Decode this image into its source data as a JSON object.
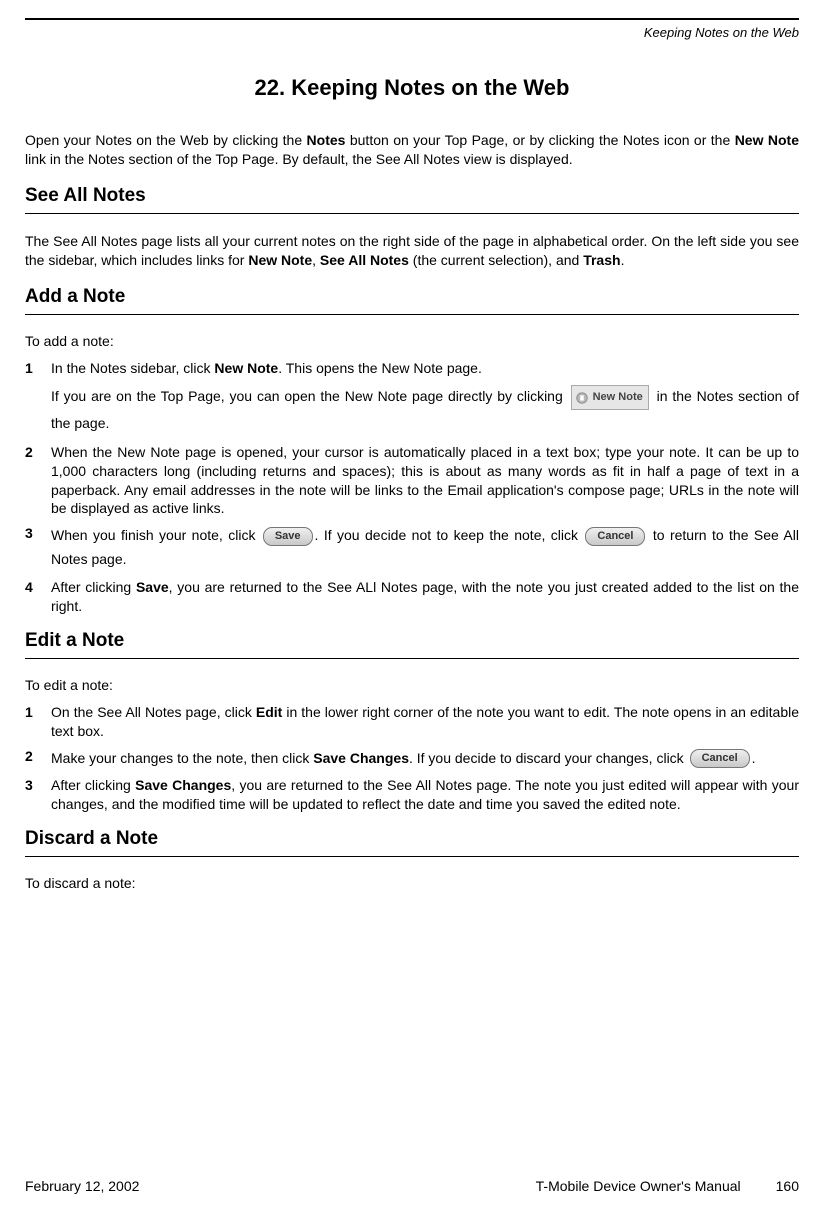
{
  "running_header": "Keeping Notes on the Web",
  "chapter_title": "22.  Keeping Notes on the Web",
  "intro_p1a": "Open your Notes on the Web by clicking the ",
  "intro_p1b": "Notes",
  "intro_p1c": " button on your Top Page, or by clicking the Notes icon or the ",
  "intro_p1d": "New Note",
  "intro_p1e": " link in the Notes section of the Top Page. By default, the See All Notes view is displayed.",
  "sec_see_all": "See All Notes",
  "see_all_p1a": "The See All Notes page lists all your current notes on the right side of the page in alphabetical order. On the left side you see the sidebar, which includes links for ",
  "see_all_p1b": "New Note",
  "see_all_p1c": ", ",
  "see_all_p1d": "See All Notes",
  "see_all_p1e": " (the current selection), and ",
  "see_all_p1f": "Trash",
  "see_all_p1g": ".",
  "sec_add": "Add a Note",
  "add_intro": "To add a note:",
  "add_s1_num": "1",
  "add_s1a": "In the Notes sidebar, click ",
  "add_s1b": "New Note",
  "add_s1c": ". This opens the New Note page.",
  "add_s1d": "If you are on the Top Page, you can open the New Note page directly by clicking ",
  "add_s1e": " in the Notes section of the page.",
  "new_note_btn_label": "New  Note",
  "add_s2_num": "2",
  "add_s2": "When the New Note page is opened, your cursor is automatically placed in a text box; type your note. It can be up to 1,000 characters long (including returns and spaces); this is about as many words as fit in half a page of text in a paperback. Any email addresses in the note will be links to the Email application's compose page; URLs in the note will be displayed as active links.",
  "add_s3_num": "3",
  "add_s3a": "When you finish your note, click ",
  "add_s3b": ". If you decide not to keep the note, click ",
  "add_s3c": " to return to the See All Notes page.",
  "save_label": "Save",
  "cancel_label": "Cancel",
  "add_s4_num": "4",
  "add_s4a": "After clicking ",
  "add_s4b": "Save",
  "add_s4c": ", you are returned to the See ALl Notes page, with the note you just created added to the list on the right.",
  "sec_edit": "Edit a Note",
  "edit_intro": "To edit a note:",
  "edit_s1_num": "1",
  "edit_s1a": "On the See All Notes page, click ",
  "edit_s1b": "Edit",
  "edit_s1c": " in the lower right corner of the note you want to edit. The note opens in an editable text box.",
  "edit_s2_num": "2",
  "edit_s2a": "Make your changes to the note, then click ",
  "edit_s2b": "Save Changes",
  "edit_s2c": ". If you decide to discard your changes, click ",
  "edit_s2d": ".",
  "edit_s3_num": "3",
  "edit_s3a": "After clicking ",
  "edit_s3b": "Save Changes",
  "edit_s3c": ", you are returned to the See All Notes page. The note you just edited will appear with your changes, and the modified time will be updated to reflect the date and time you saved the edited note.",
  "sec_discard": "Discard a Note",
  "discard_intro": "To discard a note:",
  "footer_left": "February 12, 2002",
  "footer_center": "T-Mobile Device Owner's Manual",
  "footer_right": "160"
}
